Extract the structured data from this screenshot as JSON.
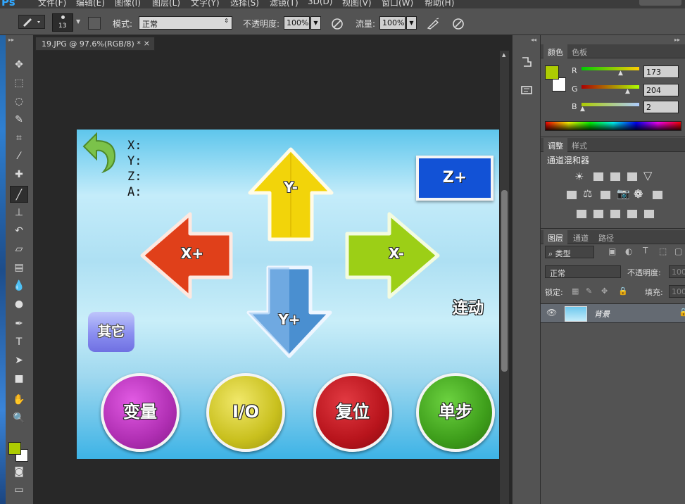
{
  "menubar": {
    "logo": "Ps",
    "items": [
      "文件(F)",
      "编辑(E)",
      "图像(I)",
      "图层(L)",
      "文字(Y)",
      "选择(S)",
      "滤镜(T)",
      "3D(D)",
      "视图(V)",
      "窗口(W)",
      "帮助(H)"
    ]
  },
  "options": {
    "brush_size": "13",
    "mode_label": "模式:",
    "mode_value": "正常",
    "opacity_label": "不透明度:",
    "opacity_value": "100%",
    "flow_label": "流量:",
    "flow_value": "100%"
  },
  "document": {
    "tab_title": "19.JPG @ 97.6%(RGB/8) *",
    "close_glyph": "×"
  },
  "canvas": {
    "coord_labels": [
      "X:",
      "Y:",
      "Z:",
      "A:"
    ],
    "z_plus": "Z+",
    "y_minus": "Y-",
    "y_plus": "Y+",
    "x_plus": "X+",
    "x_minus": "X-",
    "linkage": "连动",
    "other": "其它",
    "round_buttons": [
      "变量",
      "I/O",
      "复位",
      "单步"
    ]
  },
  "color_panel": {
    "tabs": [
      "颜色",
      "色板"
    ],
    "labels": [
      "R",
      "G",
      "B"
    ],
    "values": [
      "173",
      "204",
      "2"
    ],
    "fg_color": "#adcc02"
  },
  "adjust_panel": {
    "tabs": [
      "调整",
      "样式"
    ],
    "title": "通道混和器"
  },
  "layers_panel": {
    "tabs": [
      "图层",
      "通道",
      "路径"
    ],
    "filter_label": "类型",
    "blend_mode": "正常",
    "opacity_label": "不透明度:",
    "opacity_value": "100",
    "lock_label": "锁定:",
    "fill_label": "填充:",
    "fill_value": "100",
    "layer_name": "背景"
  },
  "colors": {
    "z_button": "#1252d6",
    "arrow_up": "#f2d40a",
    "arrow_left": "#e0401a",
    "arrow_right": "#9ccf16",
    "arrow_down": "#4a8fd0",
    "btn_variable": "#b02fb3",
    "btn_io": "#c9c01e",
    "btn_reset": "#b8141c",
    "btn_step": "#3e9e1b",
    "btn_other": "#8a8ef0"
  }
}
